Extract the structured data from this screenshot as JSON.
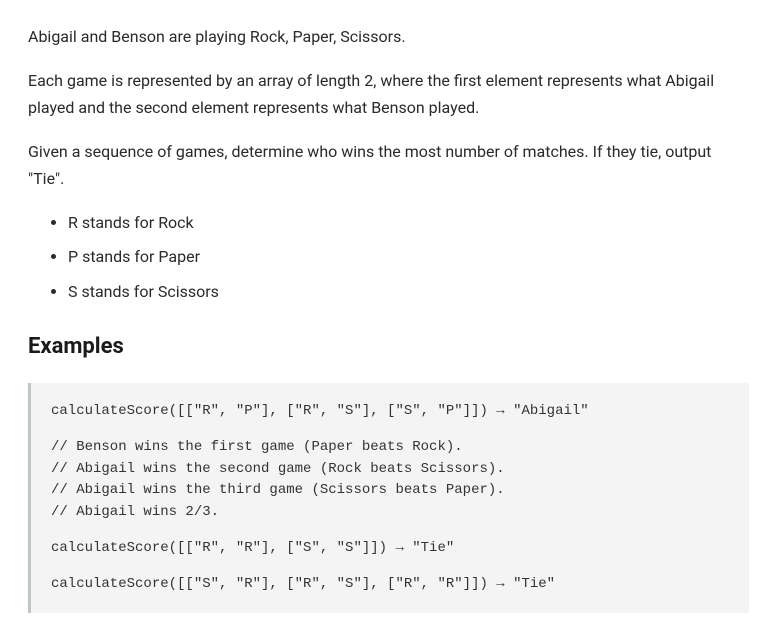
{
  "intro": {
    "p1": "Abigail and Benson are playing Rock, Paper, Scissors.",
    "p2": "Each game is represented by an array of length 2, where the first element represents what Abigail played and the second element represents what Benson played.",
    "p3": "Given a sequence of games, determine who wins the most number of matches. If they tie, output \"Tie\"."
  },
  "legend": [
    "R stands for Rock",
    "P stands for Paper",
    "S stands for Scissors"
  ],
  "examples_heading": "Examples",
  "code": {
    "ex1": "calculateScore([[\"R\", \"P\"], [\"R\", \"S\"], [\"S\", \"P\"]]) → \"Abigail\"",
    "c1": "// Benson wins the first game (Paper beats Rock).",
    "c2": "// Abigail wins the second game (Rock beats Scissors).",
    "c3": "// Abigail wins the third game (Scissors beats Paper).",
    "c4": "// Abigail wins 2/3.",
    "ex2": "calculateScore([[\"R\", \"R\"], [\"S\", \"S\"]]) → \"Tie\"",
    "ex3": "calculateScore([[\"S\", \"R\"], [\"R\", \"S\"], [\"R\", \"R\"]]) → \"Tie\""
  }
}
